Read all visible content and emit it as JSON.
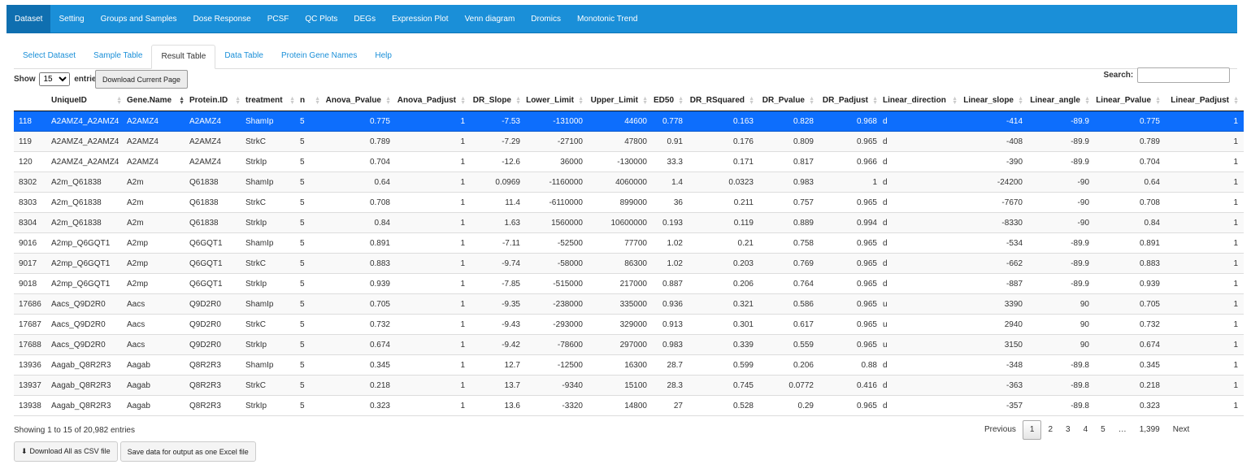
{
  "nav": [
    "Dataset",
    "Setting",
    "Groups and Samples",
    "Dose Response",
    "PCSF",
    "QC Plots",
    "DEGs",
    "Expression Plot",
    "Venn diagram",
    "Dromics",
    "Monotonic Trend"
  ],
  "nav_active": 0,
  "tabs": [
    "Select Dataset",
    "Sample Table",
    "Result Table",
    "Data Table",
    "Protein Gene Names",
    "Help"
  ],
  "tabs_active": 2,
  "length_menu": {
    "show": "Show",
    "selected": "15",
    "entries": "entries"
  },
  "download_page_label": "Download Current Page",
  "search_label": "Search:",
  "columns": [
    "",
    "UniqueID",
    "Gene.Name",
    "Protein.ID",
    "treatment",
    "n",
    "Anova_Pvalue",
    "Anova_Padjust",
    "DR_Slope",
    "Lower_Limit",
    "Upper_Limit",
    "ED50",
    "DR_RSquared",
    "DR_Pvalue",
    "DR_Padjust",
    "Linear_direction",
    "Linear_slope",
    "Linear_angle",
    "Linear_Pvalue",
    "Linear_Padjust"
  ],
  "sorted_column": 2,
  "selected_row": 0,
  "rows": [
    [
      "118",
      "A2AMZ4_A2AMZ4",
      "A2AMZ4",
      "A2AMZ4",
      "ShamIp",
      "5",
      "0.775",
      "1",
      "-7.53",
      "-131000",
      "44600",
      "0.778",
      "0.163",
      "0.828",
      "0.968",
      "d",
      "-414",
      "-89.9",
      "0.775",
      "1"
    ],
    [
      "119",
      "A2AMZ4_A2AMZ4",
      "A2AMZ4",
      "A2AMZ4",
      "StrkC",
      "5",
      "0.789",
      "1",
      "-7.29",
      "-27100",
      "47800",
      "0.91",
      "0.176",
      "0.809",
      "0.965",
      "d",
      "-408",
      "-89.9",
      "0.789",
      "1"
    ],
    [
      "120",
      "A2AMZ4_A2AMZ4",
      "A2AMZ4",
      "A2AMZ4",
      "StrkIp",
      "5",
      "0.704",
      "1",
      "-12.6",
      "36000",
      "-130000",
      "33.3",
      "0.171",
      "0.817",
      "0.966",
      "d",
      "-390",
      "-89.9",
      "0.704",
      "1"
    ],
    [
      "8302",
      "A2m_Q61838",
      "A2m",
      "Q61838",
      "ShamIp",
      "5",
      "0.64",
      "1",
      "0.0969",
      "-1160000",
      "4060000",
      "1.4",
      "0.0323",
      "0.983",
      "1",
      "d",
      "-24200",
      "-90",
      "0.64",
      "1"
    ],
    [
      "8303",
      "A2m_Q61838",
      "A2m",
      "Q61838",
      "StrkC",
      "5",
      "0.708",
      "1",
      "11.4",
      "-6110000",
      "899000",
      "36",
      "0.211",
      "0.757",
      "0.965",
      "d",
      "-7670",
      "-90",
      "0.708",
      "1"
    ],
    [
      "8304",
      "A2m_Q61838",
      "A2m",
      "Q61838",
      "StrkIp",
      "5",
      "0.84",
      "1",
      "1.63",
      "1560000",
      "10600000",
      "0.193",
      "0.119",
      "0.889",
      "0.994",
      "d",
      "-8330",
      "-90",
      "0.84",
      "1"
    ],
    [
      "9016",
      "A2mp_Q6GQT1",
      "A2mp",
      "Q6GQT1",
      "ShamIp",
      "5",
      "0.891",
      "1",
      "-7.11",
      "-52500",
      "77700",
      "1.02",
      "0.21",
      "0.758",
      "0.965",
      "d",
      "-534",
      "-89.9",
      "0.891",
      "1"
    ],
    [
      "9017",
      "A2mp_Q6GQT1",
      "A2mp",
      "Q6GQT1",
      "StrkC",
      "5",
      "0.883",
      "1",
      "-9.74",
      "-58000",
      "86300",
      "1.02",
      "0.203",
      "0.769",
      "0.965",
      "d",
      "-662",
      "-89.9",
      "0.883",
      "1"
    ],
    [
      "9018",
      "A2mp_Q6GQT1",
      "A2mp",
      "Q6GQT1",
      "StrkIp",
      "5",
      "0.939",
      "1",
      "-7.85",
      "-515000",
      "217000",
      "0.887",
      "0.206",
      "0.764",
      "0.965",
      "d",
      "-887",
      "-89.9",
      "0.939",
      "1"
    ],
    [
      "17686",
      "Aacs_Q9D2R0",
      "Aacs",
      "Q9D2R0",
      "ShamIp",
      "5",
      "0.705",
      "1",
      "-9.35",
      "-238000",
      "335000",
      "0.936",
      "0.321",
      "0.586",
      "0.965",
      "u",
      "3390",
      "90",
      "0.705",
      "1"
    ],
    [
      "17687",
      "Aacs_Q9D2R0",
      "Aacs",
      "Q9D2R0",
      "StrkC",
      "5",
      "0.732",
      "1",
      "-9.43",
      "-293000",
      "329000",
      "0.913",
      "0.301",
      "0.617",
      "0.965",
      "u",
      "2940",
      "90",
      "0.732",
      "1"
    ],
    [
      "17688",
      "Aacs_Q9D2R0",
      "Aacs",
      "Q9D2R0",
      "StrkIp",
      "5",
      "0.674",
      "1",
      "-9.42",
      "-78600",
      "297000",
      "0.983",
      "0.339",
      "0.559",
      "0.965",
      "u",
      "3150",
      "90",
      "0.674",
      "1"
    ],
    [
      "13936",
      "Aagab_Q8R2R3",
      "Aagab",
      "Q8R2R3",
      "ShamIp",
      "5",
      "0.345",
      "1",
      "12.7",
      "-12500",
      "16300",
      "28.7",
      "0.599",
      "0.206",
      "0.88",
      "d",
      "-348",
      "-89.8",
      "0.345",
      "1"
    ],
    [
      "13937",
      "Aagab_Q8R2R3",
      "Aagab",
      "Q8R2R3",
      "StrkC",
      "5",
      "0.218",
      "1",
      "13.7",
      "-9340",
      "15100",
      "28.3",
      "0.745",
      "0.0772",
      "0.416",
      "d",
      "-363",
      "-89.8",
      "0.218",
      "1"
    ],
    [
      "13938",
      "Aagab_Q8R2R3",
      "Aagab",
      "Q8R2R3",
      "StrkIp",
      "5",
      "0.323",
      "1",
      "13.6",
      "-3320",
      "14800",
      "27",
      "0.528",
      "0.29",
      "0.965",
      "d",
      "-357",
      "-89.8",
      "0.323",
      "1"
    ]
  ],
  "info": "Showing 1 to 15 of 20,982 entries",
  "pager": {
    "previous": "Previous",
    "pages": [
      "1",
      "2",
      "3",
      "4",
      "5"
    ],
    "current": "1",
    "ellipsis": "…",
    "last": "1,399",
    "next": "Next"
  },
  "bottom_buttons": {
    "csv": "Download All as CSV file",
    "excel": "Save data for output as one Excel file"
  },
  "icons": {
    "download": "download-icon",
    "sort": "sort-arrows-icon"
  },
  "colors": {
    "navbar": "#1a8fd8",
    "selected_row": "#0d6efd",
    "link": "#1a8fd8"
  }
}
